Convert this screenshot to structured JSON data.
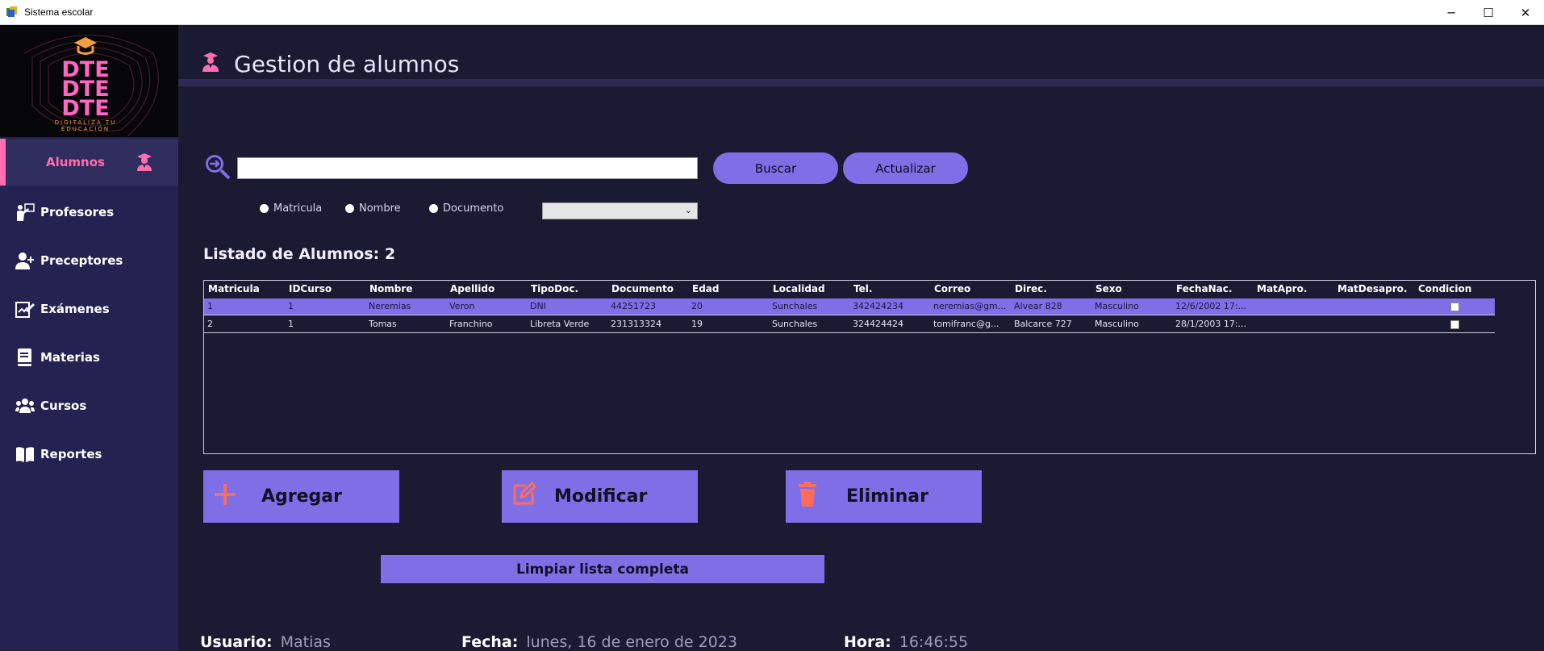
{
  "window": {
    "title": "Sistema escolar",
    "minimize": "─",
    "maximize": "☐",
    "close": "✕"
  },
  "logo": {
    "line1": "DTE",
    "line2": "DTE",
    "line3": "DTE",
    "tagline1": "DIGITALIZA TU",
    "tagline2": "EDUCACIÓN"
  },
  "sidebar": {
    "items": [
      {
        "label": "Alumnos",
        "icon": "student-icon",
        "active": true
      },
      {
        "label": "Profesores",
        "icon": "teacher-icon"
      },
      {
        "label": "Preceptores",
        "icon": "user-plus-icon"
      },
      {
        "label": "Exámenes",
        "icon": "exam-icon"
      },
      {
        "label": "Materias",
        "icon": "book-icon"
      },
      {
        "label": "Cursos",
        "icon": "users-icon"
      },
      {
        "label": "Reportes",
        "icon": "open-book-icon"
      }
    ]
  },
  "header": {
    "title": "Gestion de alumnos"
  },
  "search": {
    "value": "",
    "buscar": "Buscar",
    "actualizar": "Actualizar"
  },
  "filters": {
    "matricula": "Matricula",
    "nombre": "Nombre",
    "documento": "Documento",
    "select_value": ""
  },
  "listado": {
    "label": "Listado de Alumnos: 2"
  },
  "table": {
    "headers": [
      "Matricula",
      "IDCurso",
      "Nombre",
      "Apellido",
      "TipoDoc.",
      "Documento",
      "Edad",
      "Localidad",
      "Tel.",
      "Correo",
      "Direc.",
      "Sexo",
      "FechaNac.",
      "MatApro.",
      "MatDesapro.",
      "Condicion"
    ],
    "rows": [
      [
        "1",
        "1",
        "Neremias",
        "Veron",
        "DNI",
        "44251723",
        "20",
        "Sunchales",
        "342424234",
        "neremias@gm...",
        "Alvear 828",
        "Masculino",
        "12/6/2002 17:...",
        "",
        ""
      ],
      [
        "2",
        "1",
        "Tomas",
        "Franchino",
        "Libreta Verde",
        "231313324",
        "19",
        "Sunchales",
        "324424424",
        "tomifranc@g...",
        "Balcarce 727",
        "Masculino",
        "28/1/2003 17:...",
        "",
        ""
      ]
    ]
  },
  "actions": {
    "agregar": "Agregar",
    "modificar": "Modificar",
    "eliminar": "Eliminar",
    "limpiar": "Limpiar lista completa"
  },
  "footer": {
    "usuario_label": "Usuario:",
    "usuario_value": "Matias",
    "fecha_label": "Fecha:",
    "fecha_value": "lunes, 16 de enero de 2023",
    "hora_label": "Hora:",
    "hora_value": "16:46:55"
  },
  "colors": {
    "accent": "#7e6fe6",
    "pink": "#ff6fb0",
    "sidebar": "#242250",
    "background": "#1b1a33",
    "icon_red": "#ff6b5a"
  }
}
